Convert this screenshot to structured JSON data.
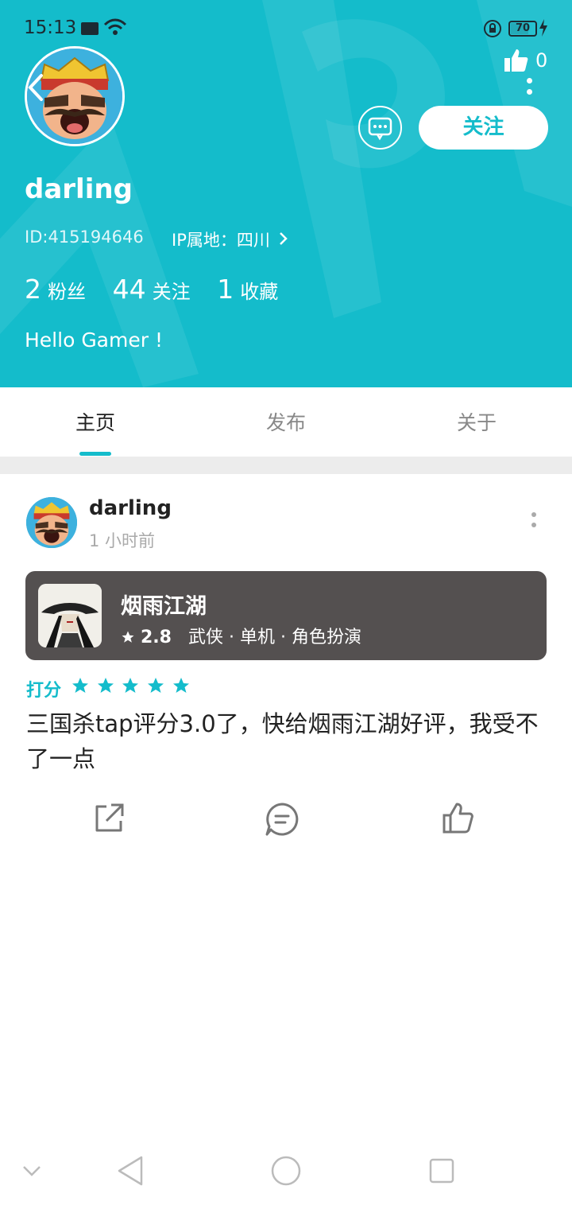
{
  "status_bar": {
    "time": "15:13",
    "battery": "70"
  },
  "profile": {
    "name": "darling",
    "id_text": "ID:415194646",
    "ip_text": "IP属地：四川",
    "like_count": "0",
    "follow_button": "关注",
    "stats": [
      {
        "num": "2",
        "label": "粉丝"
      },
      {
        "num": "44",
        "label": "关注"
      },
      {
        "num": "1",
        "label": "收藏"
      }
    ],
    "bio": "Hello Gamer !"
  },
  "tabs": [
    {
      "label": "主页"
    },
    {
      "label": "发布"
    },
    {
      "label": "关于"
    }
  ],
  "post": {
    "author": "darling",
    "time": "1 小时前",
    "game": {
      "name": "烟雨江湖",
      "score": "2.8",
      "tags": "武侠 · 单机 · 角色扮演"
    },
    "rating_label": "打分",
    "stars": 5,
    "text": "三国杀tap评分3.0了，快给烟雨江湖好评，我受不了一点"
  },
  "colors": {
    "accent": "#14bccb",
    "card": "#545050"
  },
  "icons": [
    "back-icon",
    "like-icon",
    "more-icon",
    "message-icon",
    "chevron-right-icon",
    "share-icon",
    "comment-icon",
    "thumb-up-icon",
    "nav-back-icon",
    "nav-home-icon",
    "nav-recent-icon"
  ]
}
